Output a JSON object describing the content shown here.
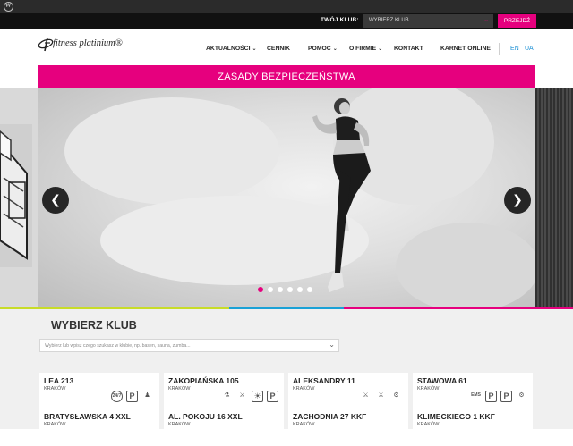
{
  "topbar": {
    "club_label": "TWÓJ KLUB:",
    "club_select": "WYBIERZ KLUB...",
    "go_button": "PRZEJDŹ"
  },
  "brand": {
    "logo_text": "fitness platinium®"
  },
  "nav": [
    {
      "label": "AKTUALNOŚCI",
      "has_submenu": true
    },
    {
      "label": "CENNIK",
      "has_submenu": false
    },
    {
      "label": "POMOC",
      "has_submenu": true
    },
    {
      "label": "O FIRMIE",
      "has_submenu": true
    },
    {
      "label": "KONTAKT",
      "has_submenu": false
    },
    {
      "label": "KARNET ONLINE",
      "has_submenu": false
    }
  ],
  "languages": [
    "EN",
    "UA"
  ],
  "banner": {
    "text": "ZASADY BEZPIECZEŃSTWA"
  },
  "slider": {
    "prev_icon": "chevron-left-icon",
    "next_icon": "chevron-right-icon",
    "slide_count": 6,
    "active_slide": 1
  },
  "club_picker": {
    "title": "WYBIERZ KLUB",
    "search_placeholder": "Wybierz lub wpisz czego szukasz w klubie, np. basen, sauna, zumba..."
  },
  "clubs": [
    {
      "name": "LEA 213",
      "city": "KRAKÓW",
      "amenities": [
        "24/7",
        "parking",
        "kids-room"
      ]
    },
    {
      "name": "ZAKOPIAŃSKA 105",
      "city": "KRAKÓW",
      "amenities": [
        "cycling",
        "gym",
        "solarium",
        "parking"
      ]
    },
    {
      "name": "ALEKSANDRY 11",
      "city": "KRAKÓW",
      "amenities": [
        "gym",
        "gym",
        "weights"
      ]
    },
    {
      "name": "STAWOWA 61",
      "city": "KRAKÓW",
      "amenities": [
        "EMS",
        "parking",
        "parking",
        "weights"
      ]
    },
    {
      "name": "BRATYSŁAWSKA 4 XXL",
      "city": "KRAKÓW",
      "amenities": []
    },
    {
      "name": "AL. POKOJU 16 XXL",
      "city": "KRAKÓW",
      "amenities": []
    },
    {
      "name": "ZACHODNIA 27 KKF",
      "city": "KRAKÓW",
      "amenities": []
    },
    {
      "name": "KLIMECKIEGO 1 KKF",
      "city": "KRAKÓW",
      "amenities": []
    }
  ],
  "colors": {
    "accent": "#e6007e",
    "dark": "#111111",
    "stripe": [
      "#c8dc28",
      "#1aa1d6",
      "#e6007e"
    ]
  }
}
